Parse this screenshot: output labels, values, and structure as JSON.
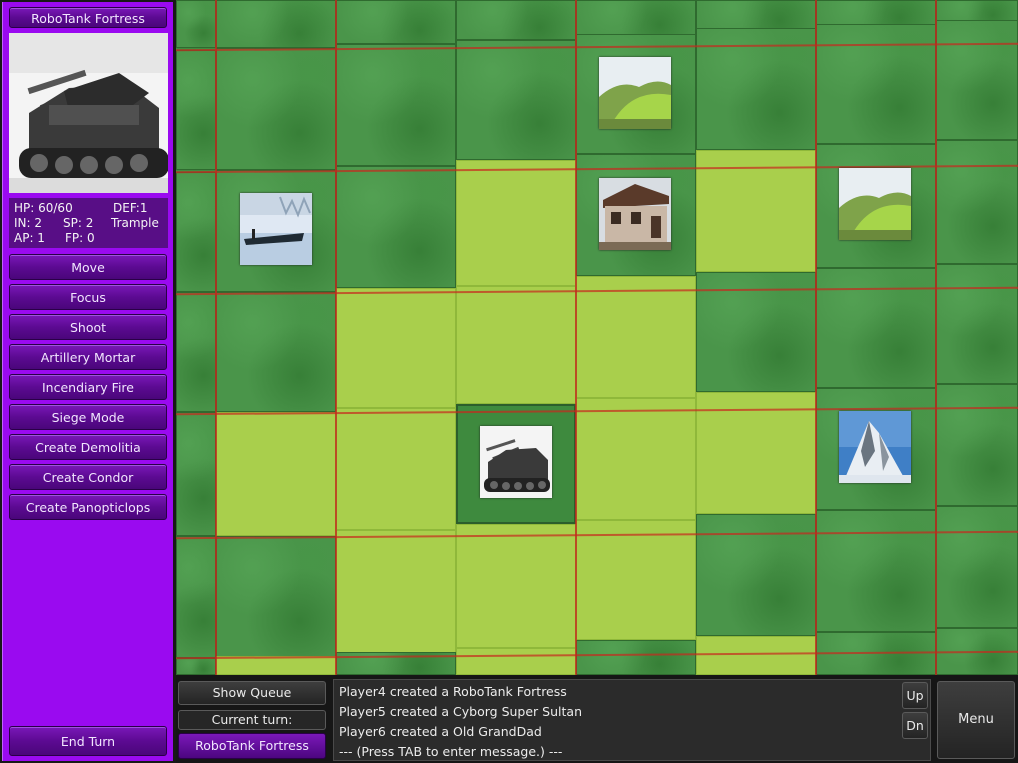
{
  "unit": {
    "name": "RoboTank Fortress",
    "stats": {
      "hp": "HP: 60/60",
      "def": "DEF:1",
      "in": "IN: 2",
      "sp": "SP: 2",
      "ability": "Trample",
      "ap": "AP: 1",
      "fp": "FP: 0"
    }
  },
  "actions": [
    "Move",
    "Focus",
    "Shoot",
    "Artillery Mortar",
    "Incendiary Fire",
    "Siege Mode",
    "Create Demolitia",
    "Create Condor",
    "Create Panopticlops"
  ],
  "end_turn_label": "End Turn",
  "queue": {
    "show_label": "Show Queue",
    "current_turn_label": "Current turn:",
    "current_turn_value": "RoboTank Fortress"
  },
  "log": {
    "lines": [
      "Player4 created a RoboTank Fortress",
      "Player5 created a Cyborg Super Sultan",
      "Player6 created a Old GrandDad",
      "--- (Press TAB to enter message.) ---"
    ],
    "up_label": "Up",
    "down_label": "Dn"
  },
  "menu_label": "Menu",
  "map": {
    "objects": [
      {
        "name": "hill-terrain-1",
        "kind": "hill"
      },
      {
        "name": "lake-boat-terrain",
        "kind": "lake"
      },
      {
        "name": "house-structure",
        "kind": "house"
      },
      {
        "name": "hill-terrain-2",
        "kind": "hill"
      },
      {
        "name": "robotank-fortress-unit",
        "kind": "tank"
      },
      {
        "name": "mountain-terrain",
        "kind": "mountain"
      }
    ]
  },
  "colors": {
    "sidebar": "#9a0af0",
    "grass": "#4a954a",
    "highlight": "#a9cf4c",
    "gridline": "#c8281e"
  }
}
